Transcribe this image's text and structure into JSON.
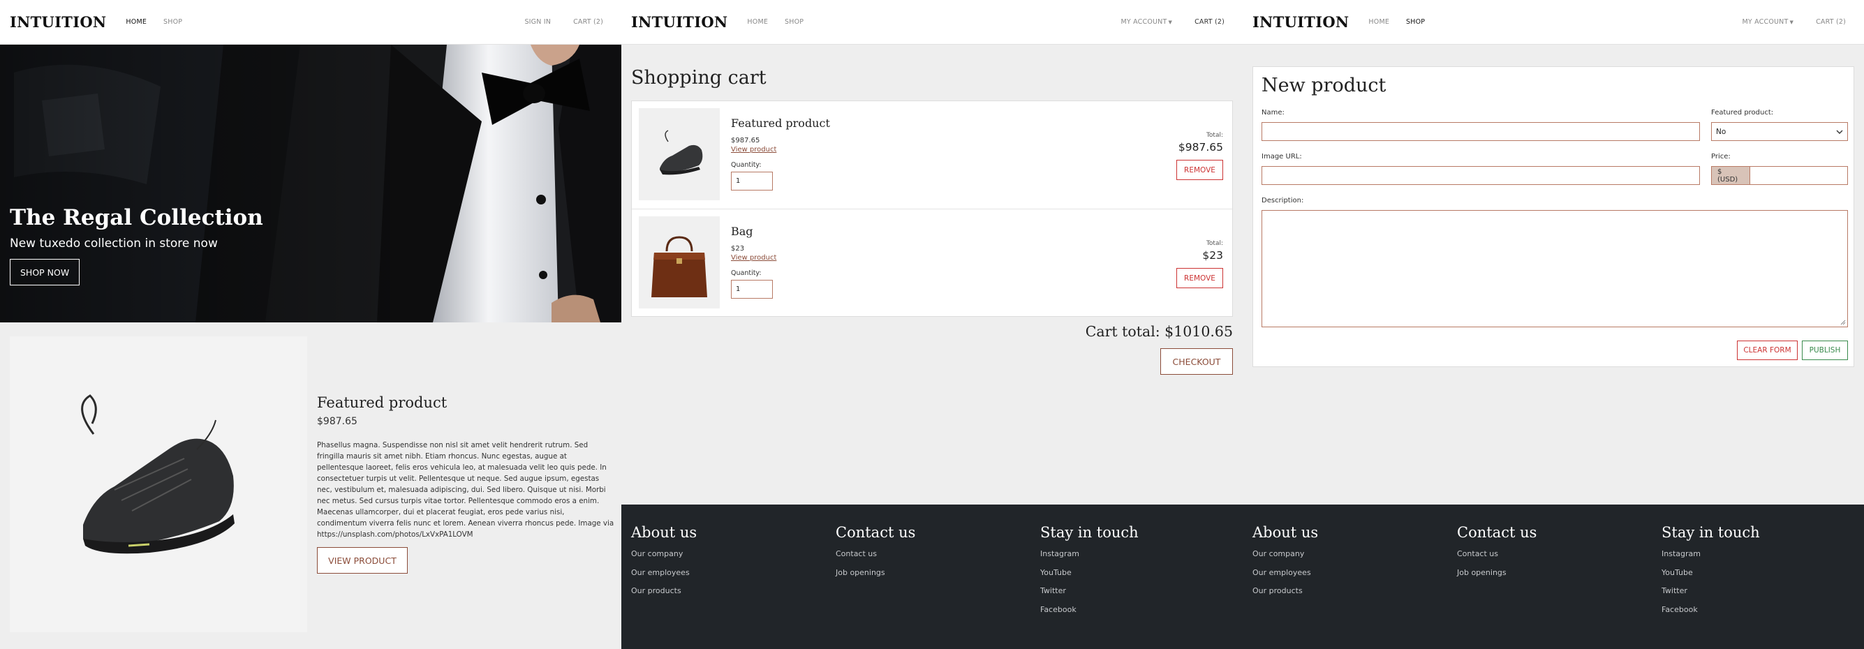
{
  "brand": "INTUITION",
  "home_page": {
    "nav": {
      "home": "HOME",
      "shop": "SHOP",
      "sign_in": "SIGN IN",
      "cart": "CART (2)"
    },
    "hero": {
      "title": "The Regal Collection",
      "subtitle": "New tuxedo collection in store now",
      "button": "SHOP NOW"
    },
    "featured": {
      "title": "Featured product",
      "price": "$987.65",
      "description": "Phasellus magna. Suspendisse non nisl sit amet velit hendrerit rutrum. Sed fringilla mauris sit amet nibh. Etiam rhoncus. Nunc egestas, augue at pellentesque laoreet, felis eros vehicula leo, at malesuada velit leo quis pede. In consectetuer turpis ut velit. Pellentesque ut neque. Sed augue ipsum, egestas nec, vestibulum et, malesuada adipiscing, dui. Sed libero. Quisque ut nisi. Morbi nec metus. Sed cursus turpis vitae tortor. Pellentesque commodo eros a enim. Maecenas ullamcorper, dui et placerat feugiat, eros pede varius nisi, condimentum viverra felis nunc et lorem. Aenean viverra rhoncus pede. Image via https://unsplash.com/photos/LxVxPA1LOVM",
      "button": "VIEW PRODUCT",
      "image_icon": "sneaker-image"
    }
  },
  "cart_page": {
    "nav": {
      "home": "HOME",
      "shop": "SHOP",
      "account": "MY ACCOUNT",
      "cart": "CART (2)"
    },
    "heading": "Shopping cart",
    "items": [
      {
        "name": "Featured product",
        "price": "$987.65",
        "link": "View product",
        "qty_label": "Quantity:",
        "qty": "1",
        "total_label": "Total:",
        "total": "$987.65",
        "remove": "REMOVE",
        "image_icon": "sneaker-image"
      },
      {
        "name": "Bag",
        "price": "$23",
        "link": "View product",
        "qty_label": "Quantity:",
        "qty": "1",
        "total_label": "Total:",
        "total": "$23",
        "remove": "REMOVE",
        "image_icon": "bag-image"
      }
    ],
    "cart_total": "Cart total: $1010.65",
    "checkout": "CHECKOUT"
  },
  "new_product_page": {
    "nav": {
      "home": "HOME",
      "shop": "SHOP",
      "account": "MY ACCOUNT",
      "cart": "CART (2)"
    },
    "title": "New product",
    "labels": {
      "name": "Name:",
      "featured": "Featured product:",
      "image_url": "Image URL:",
      "price": "Price:",
      "description": "Description:"
    },
    "featured_value": "No",
    "price_addon": "$ (USD)",
    "buttons": {
      "clear": "CLEAR FORM",
      "publish": "PUBLISH"
    }
  },
  "footer": {
    "about": {
      "title": "About us",
      "links": [
        "Our company",
        "Our employees",
        "Our products"
      ]
    },
    "contact": {
      "title": "Contact us",
      "links": [
        "Contact us",
        "Job openings"
      ]
    },
    "social": {
      "title": "Stay in touch",
      "links": [
        "Instagram",
        "YouTube",
        "Twitter",
        "Facebook"
      ]
    }
  },
  "colors": {
    "accent_brown": "#8b4c39",
    "danger_red": "#cc3333",
    "success_green": "#3a8b4d",
    "footer_bg": "#212529",
    "page_bg": "#eeeeee"
  }
}
